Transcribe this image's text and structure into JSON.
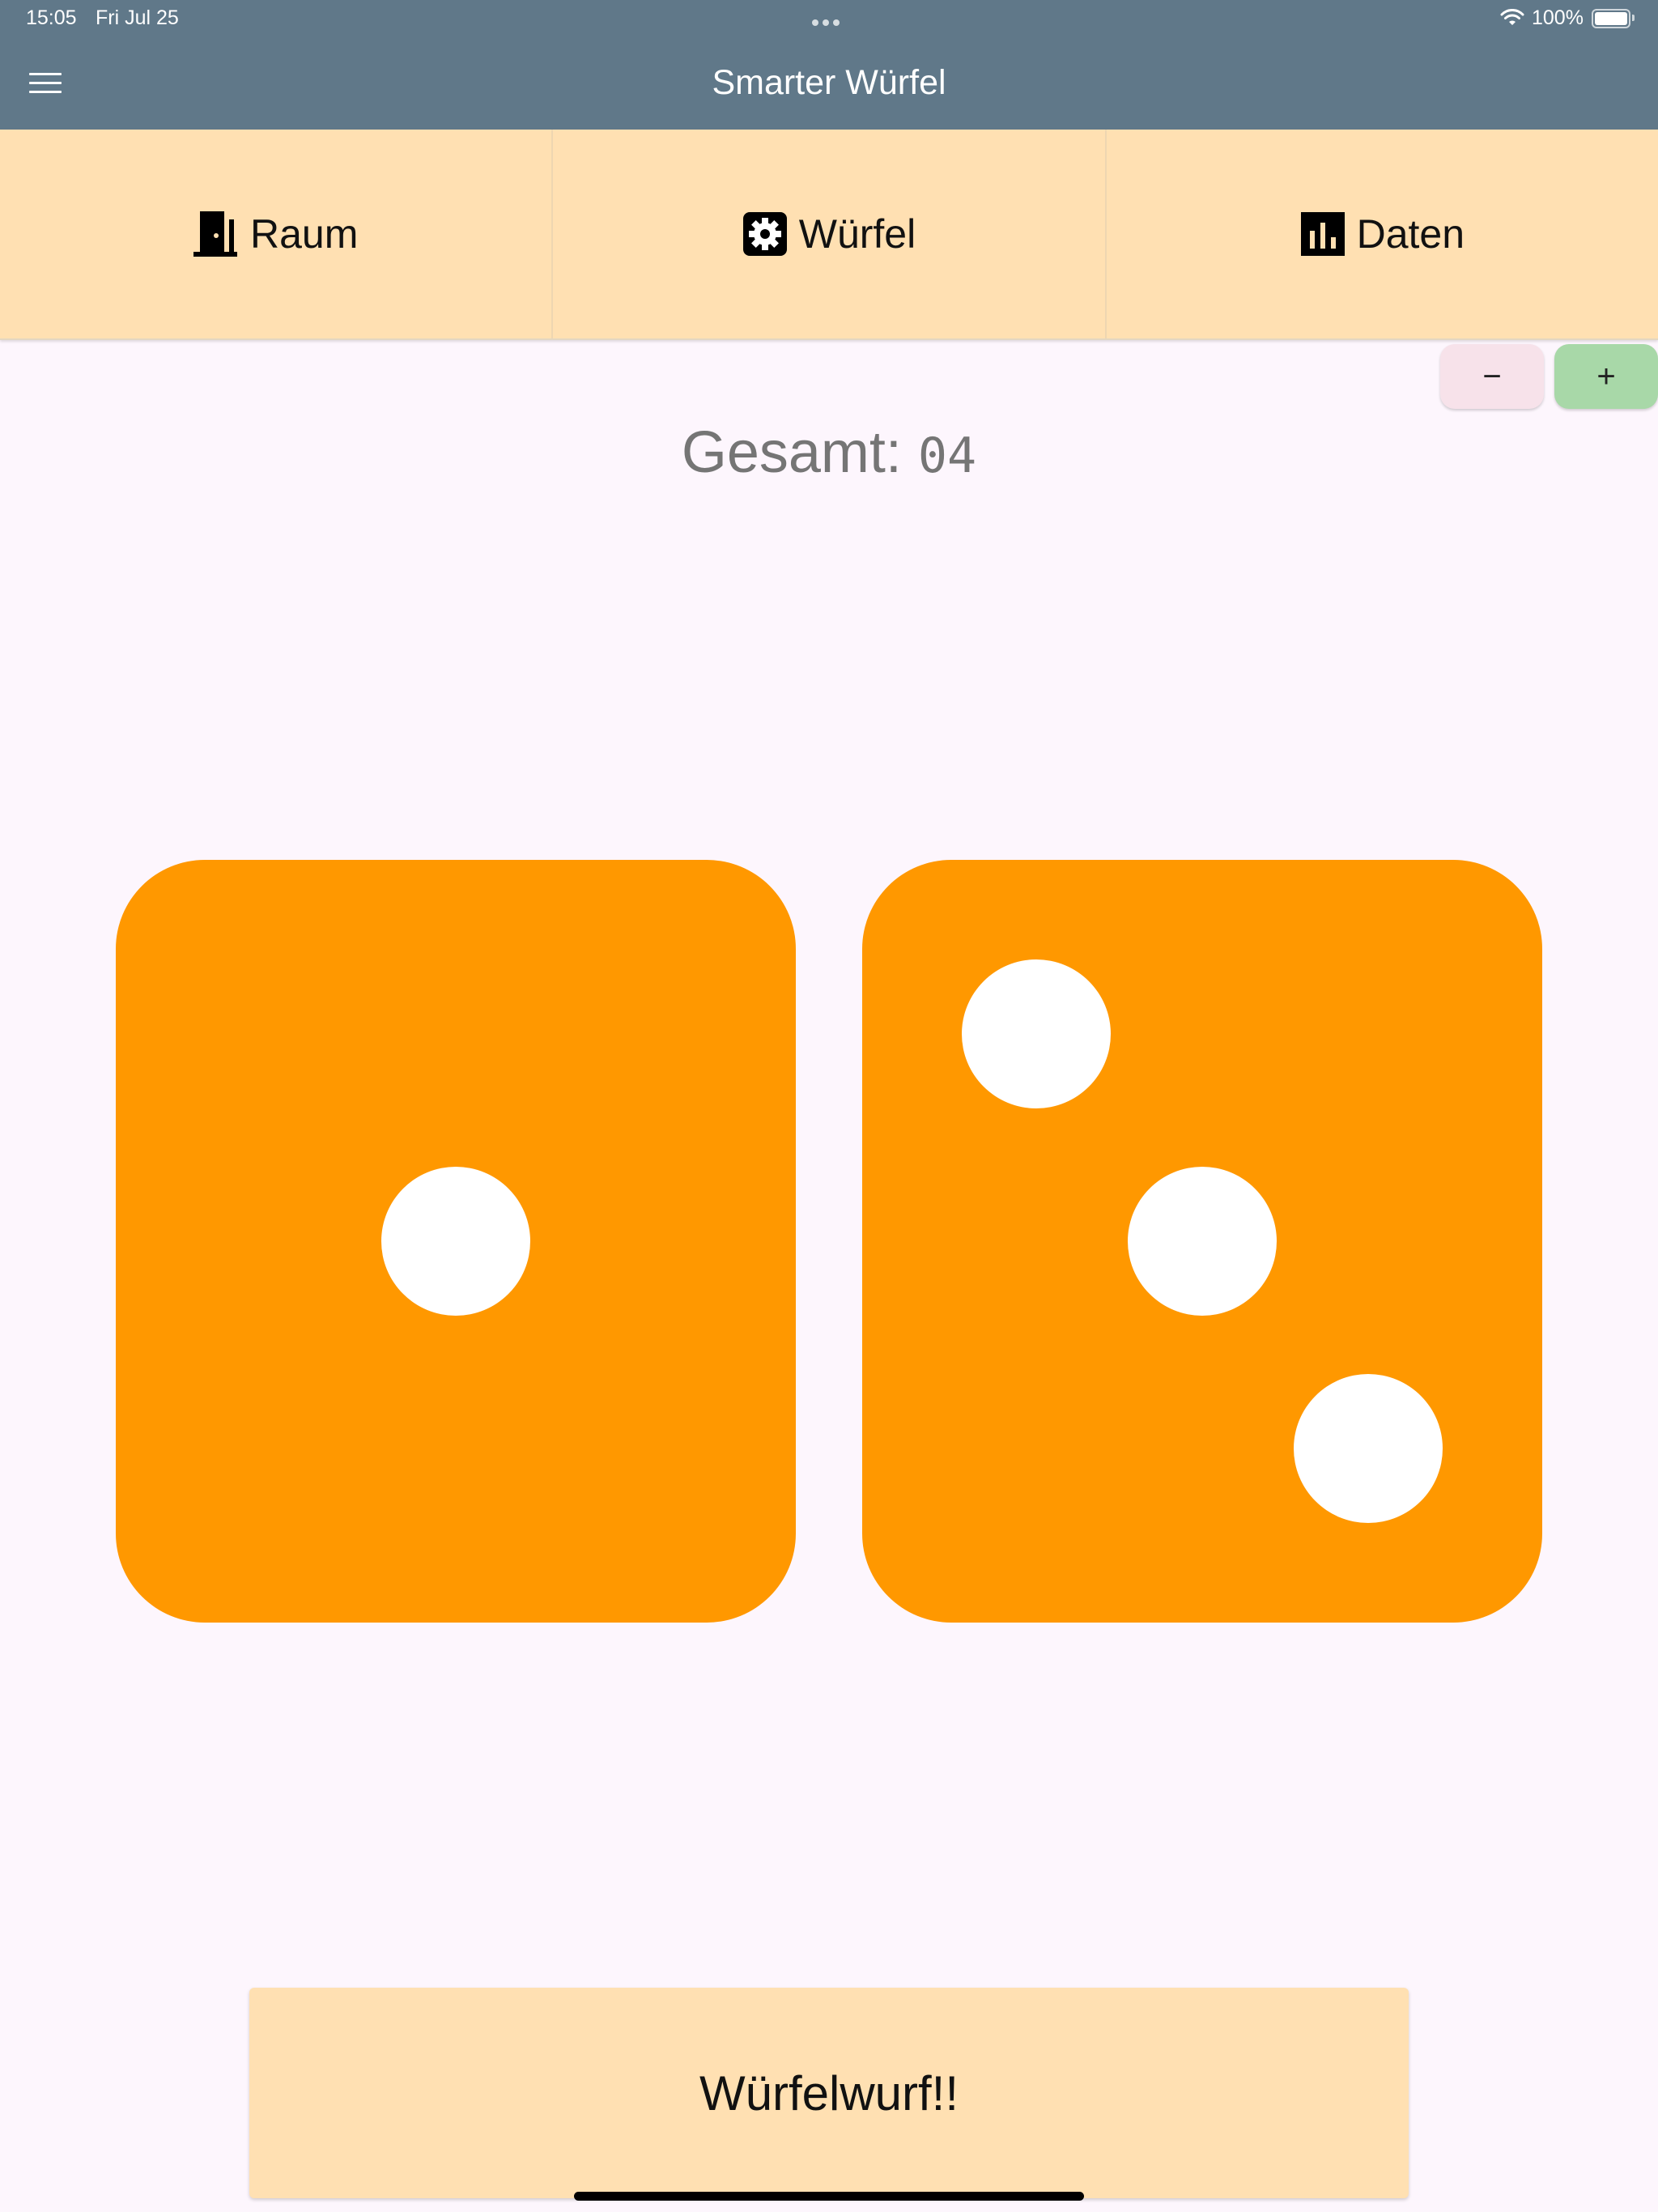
{
  "status_bar": {
    "time": "15:05",
    "date": "Fri Jul 25",
    "battery": "100%",
    "icons": [
      "multitasking-dots-icon",
      "wifi-icon",
      "battery-icon"
    ]
  },
  "app_bar": {
    "title": "Smarter Würfel",
    "menu_icon": "menu-icon",
    "background_color": "#607889"
  },
  "tabs": [
    {
      "label": "Raum",
      "icon": "door-icon"
    },
    {
      "label": "Würfel",
      "icon": "dice-settings-icon"
    },
    {
      "label": "Daten",
      "icon": "bar-chart-icon"
    }
  ],
  "stepper": {
    "minus_label": "−",
    "plus_label": "+"
  },
  "total": {
    "label": "Gesamt:",
    "value": "04"
  },
  "dice": [
    {
      "value": 1
    },
    {
      "value": 3
    }
  ],
  "colors": {
    "die": "#ff9800",
    "pip": "#ffffff",
    "tab_background": "#ffe0b2",
    "page_background": "#fdf6fd",
    "minus_button": "#f7e2ea",
    "plus_button": "#a8d8a8"
  },
  "roll_button": {
    "label": "Würfelwurf!!"
  }
}
